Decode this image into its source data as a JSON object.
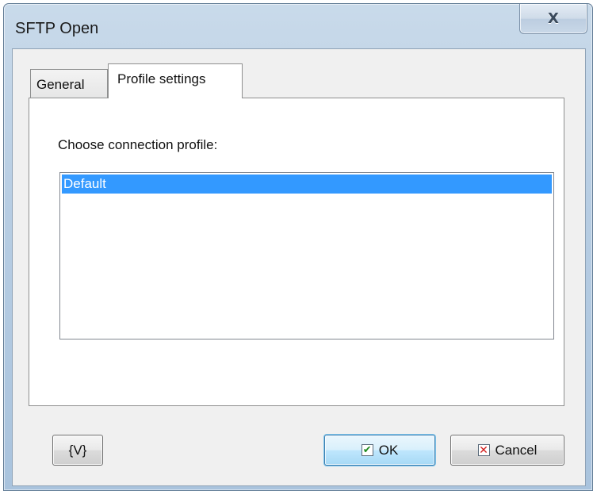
{
  "window": {
    "title": "SFTP Open",
    "close_glyph": "X"
  },
  "tabs": [
    {
      "label": "General",
      "active": false
    },
    {
      "label": "Profile settings",
      "active": true
    }
  ],
  "profile_settings": {
    "choose_label": "Choose connection profile:",
    "profiles": [
      {
        "label": "Default",
        "selected": true
      }
    ]
  },
  "buttons": {
    "variables_label": "{V}",
    "ok_label": "OK",
    "ok_icon": "checkmark-icon",
    "cancel_label": "Cancel",
    "cancel_icon": "red-x-icon"
  },
  "colors": {
    "selection": "#3399ff",
    "ok_check": "#1e8a1e",
    "cancel_x": "#d11a1a"
  }
}
